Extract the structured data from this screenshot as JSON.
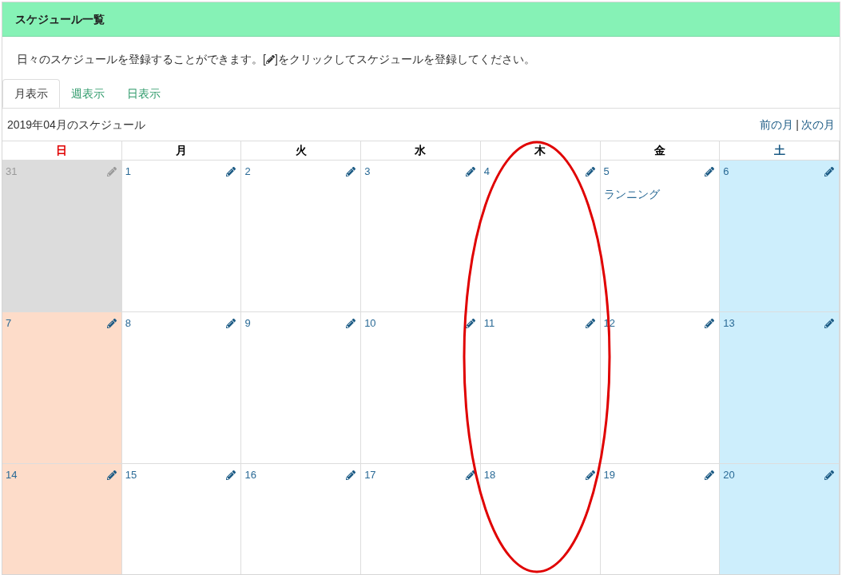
{
  "panel": {
    "title": "スケジュール一覧"
  },
  "description": {
    "before": "日々のスケジュールを登録することができます。[",
    "after": "]をクリックしてスケジュールを登録してください。"
  },
  "tabs": [
    {
      "label": "月表示",
      "selected": true
    },
    {
      "label": "週表示",
      "selected": false
    },
    {
      "label": "日表示",
      "selected": false
    }
  ],
  "calendar": {
    "title": "2019年04月のスケジュール",
    "prev": "前の月",
    "separator": "|",
    "next": "次の月",
    "weekdays": [
      {
        "label": "日",
        "kind": "sunday"
      },
      {
        "label": "月",
        "kind": "weekday"
      },
      {
        "label": "火",
        "kind": "weekday"
      },
      {
        "label": "水",
        "kind": "weekday"
      },
      {
        "label": "木",
        "kind": "weekday"
      },
      {
        "label": "金",
        "kind": "weekday"
      },
      {
        "label": "土",
        "kind": "saturday"
      }
    ],
    "weeks": [
      [
        {
          "day": "31",
          "kind": "other_month"
        },
        {
          "day": "1",
          "kind": "weekday"
        },
        {
          "day": "2",
          "kind": "weekday"
        },
        {
          "day": "3",
          "kind": "weekday"
        },
        {
          "day": "4",
          "kind": "weekday"
        },
        {
          "day": "5",
          "kind": "weekday",
          "events": [
            "ランニング"
          ]
        },
        {
          "day": "6",
          "kind": "saturday"
        }
      ],
      [
        {
          "day": "7",
          "kind": "sunday"
        },
        {
          "day": "8",
          "kind": "weekday"
        },
        {
          "day": "9",
          "kind": "weekday"
        },
        {
          "day": "10",
          "kind": "weekday"
        },
        {
          "day": "11",
          "kind": "weekday"
        },
        {
          "day": "12",
          "kind": "weekday"
        },
        {
          "day": "13",
          "kind": "saturday"
        }
      ],
      [
        {
          "day": "14",
          "kind": "sunday"
        },
        {
          "day": "15",
          "kind": "weekday"
        },
        {
          "day": "16",
          "kind": "weekday"
        },
        {
          "day": "17",
          "kind": "weekday"
        },
        {
          "day": "18",
          "kind": "weekday"
        },
        {
          "day": "19",
          "kind": "weekday"
        },
        {
          "day": "20",
          "kind": "saturday"
        }
      ]
    ]
  }
}
